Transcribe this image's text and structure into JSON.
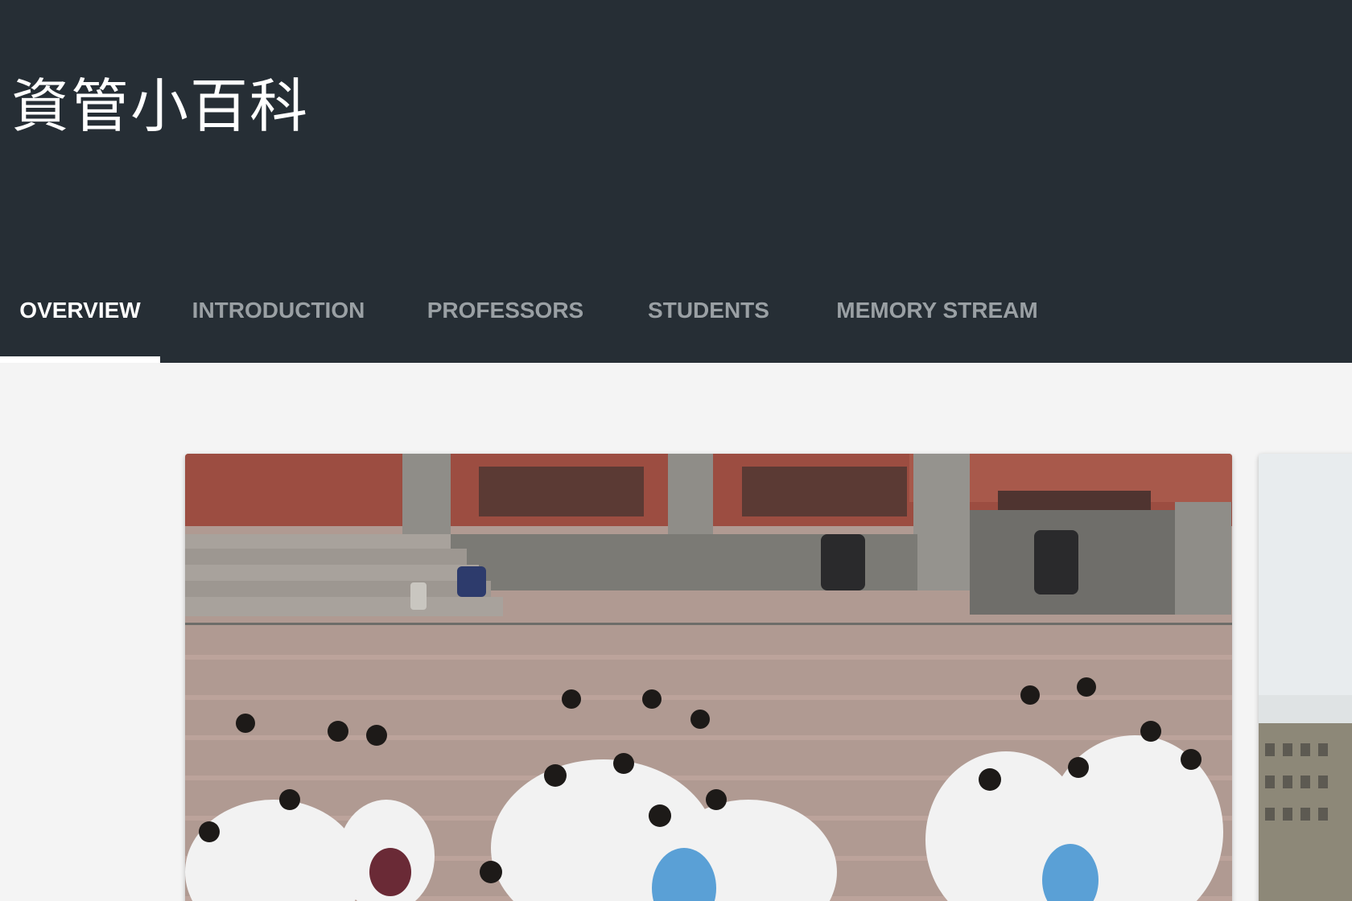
{
  "site": {
    "title": "資管小百科"
  },
  "tabs": [
    {
      "label": "OVERVIEW",
      "active": true
    },
    {
      "label": "INTRODUCTION",
      "active": false
    },
    {
      "label": "PROFESSORS",
      "active": false
    },
    {
      "label": "STUDENTS",
      "active": false
    },
    {
      "label": "MEMORY STREAM",
      "active": false
    }
  ],
  "carousel": {
    "slides": [
      {
        "description": "group-photo-students"
      },
      {
        "description": "building-photo"
      }
    ]
  },
  "colors": {
    "header_bg": "#262e35",
    "page_bg": "#f4f4f4",
    "tab_active": "#ffffff",
    "tab_inactive": "#9aa0a4"
  }
}
